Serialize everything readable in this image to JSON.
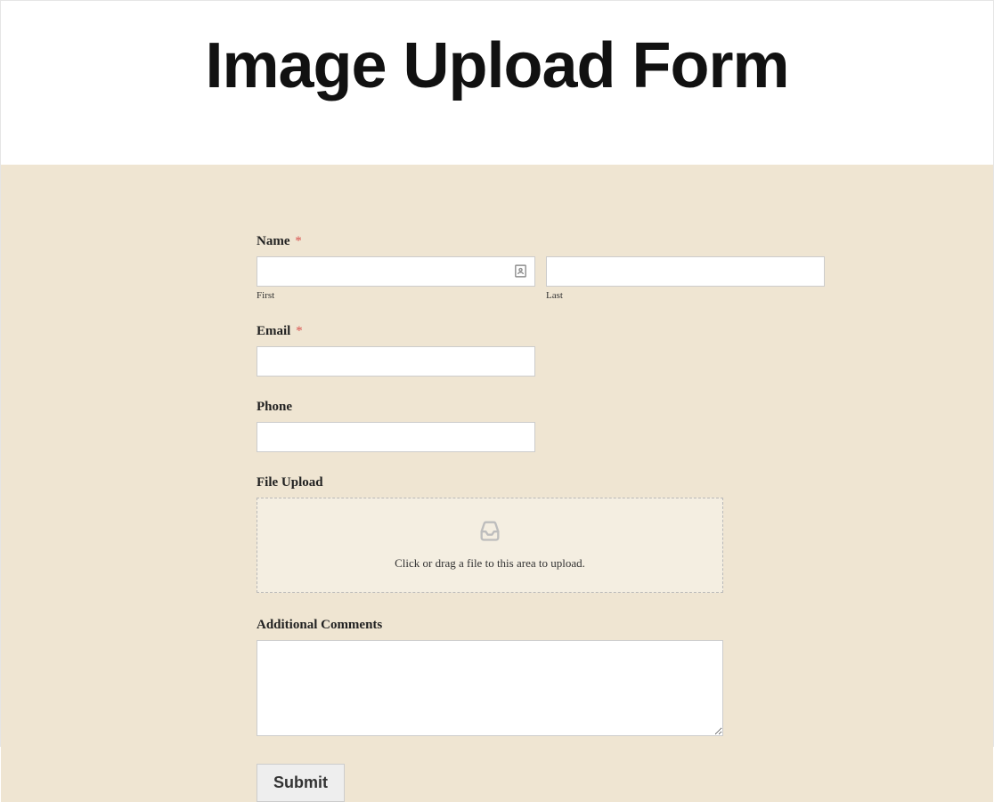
{
  "header": {
    "title": "Image Upload Form"
  },
  "form": {
    "name": {
      "label": "Name",
      "required_marker": "*",
      "first": {
        "sublabel": "First",
        "value": ""
      },
      "last": {
        "sublabel": "Last",
        "value": ""
      }
    },
    "email": {
      "label": "Email",
      "required_marker": "*",
      "value": ""
    },
    "phone": {
      "label": "Phone",
      "value": ""
    },
    "file_upload": {
      "label": "File Upload",
      "dropzone_text": "Click or drag a file to this area to upload."
    },
    "comments": {
      "label": "Additional Comments",
      "value": ""
    },
    "submit": {
      "label": "Submit"
    }
  }
}
